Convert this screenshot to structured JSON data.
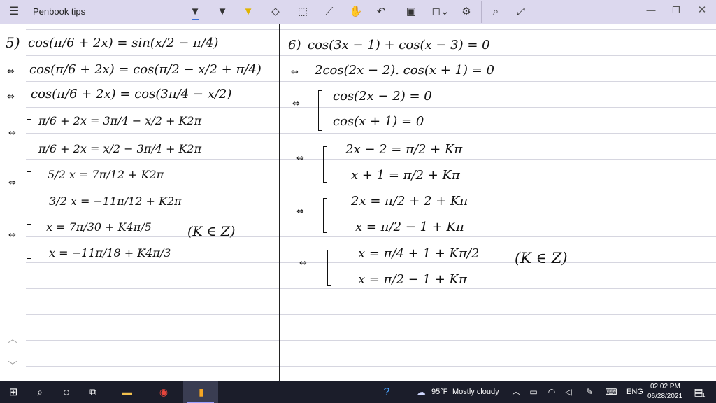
{
  "app": {
    "title": "Penbook tips"
  },
  "icons": {
    "menu": "hamburger-menu-icon",
    "tools": [
      "pen-black-icon",
      "pen-dark-icon",
      "highlighter-icon",
      "eraser-icon",
      "lasso-select-icon",
      "ruler-icon",
      "touch-write-icon",
      "undo-icon",
      "image-icon",
      "shapes-icon",
      "settings-icon",
      "search-icon",
      "expand-icon"
    ],
    "window": [
      "minimize-icon",
      "maximize-icon",
      "close-icon"
    ]
  },
  "notes": {
    "left": [
      {
        "prefix": "5)",
        "text": "cos(π/6 + 2x) = sin(x/2 − π/4)"
      },
      {
        "prefix": "⇔",
        "text": "cos(π/6 + 2x) = cos(π/2 − x/2 + π/4)"
      },
      {
        "prefix": "⇔",
        "text": "cos(π/6 + 2x) = cos(3π/4 − x/2)"
      },
      {
        "prefix": "⇔",
        "text": "π/6 + 2x = 3π/4 − x/2 + K2π"
      },
      {
        "prefix": "",
        "text": "π/6 + 2x = x/2 − 3π/4 + K2π"
      },
      {
        "prefix": "⇔",
        "text": "5/2 x = 7π/12 + K2π"
      },
      {
        "prefix": "",
        "text": "3/2 x = −11π/12 + K2π"
      },
      {
        "prefix": "⇔",
        "text": "x = 7π/30 + K4π/5"
      },
      {
        "prefix": "",
        "text": "x = −11π/18 + K4π/3"
      },
      {
        "prefix": "",
        "text": "(K ∈ Z)"
      }
    ],
    "right": [
      {
        "prefix": "6)",
        "text": "cos(3x − 1) + cos(x − 3) = 0"
      },
      {
        "prefix": "⇔",
        "text": "2cos(2x − 2). cos(x + 1) = 0"
      },
      {
        "prefix": "⇔",
        "text": "cos(2x − 2) = 0"
      },
      {
        "prefix": "",
        "text": "cos(x + 1) = 0"
      },
      {
        "prefix": "⇔",
        "text": "2x − 2 = π/2 + Kπ"
      },
      {
        "prefix": "",
        "text": "x + 1 = π/2 + Kπ"
      },
      {
        "prefix": "⇔",
        "text": "2x = π/2 + 2 + Kπ"
      },
      {
        "prefix": "",
        "text": "x = π/2 − 1 + Kπ"
      },
      {
        "prefix": "⇔",
        "text": "x = π/4 + 1 + Kπ/2"
      },
      {
        "prefix": "",
        "text": "x = π/2 − 1 + Kπ"
      },
      {
        "prefix": "",
        "text": "(K ∈ Z)"
      }
    ]
  },
  "taskbar": {
    "weather_temp": "95°F",
    "weather_text": "Mostly cloudy",
    "language": "ENG",
    "time": "02:02 PM",
    "date": "06/28/2021",
    "notification_count": "1"
  }
}
